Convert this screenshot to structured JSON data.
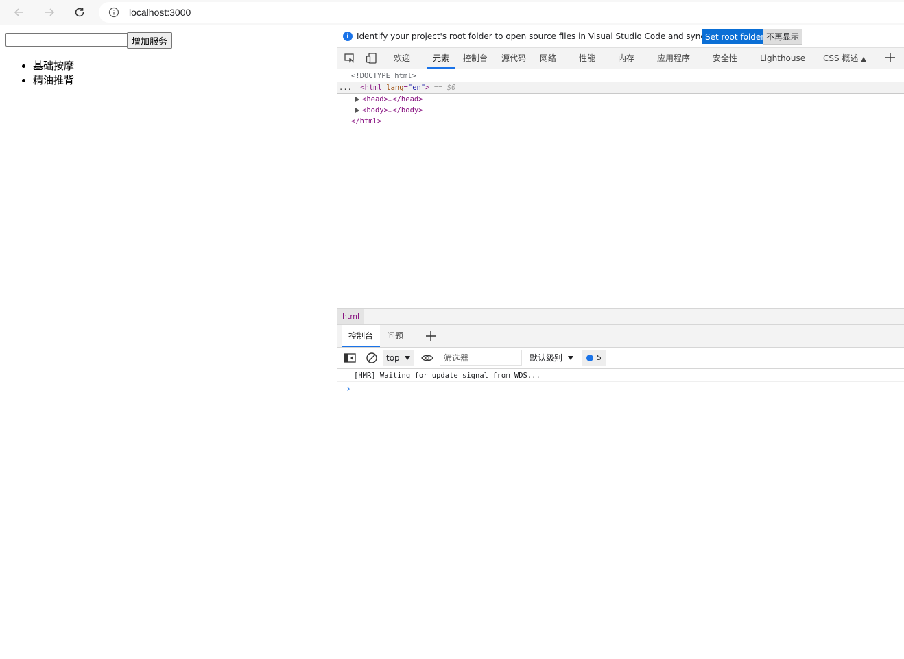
{
  "browser": {
    "url": "localhost:3000",
    "icons": {
      "back": "arrow-left-icon",
      "forward": "arrow-right-icon",
      "reload": "reload-icon",
      "info": "info-icon"
    }
  },
  "page": {
    "input_value": "",
    "add_button_label": "增加服务",
    "services": [
      "基础按摩",
      "精油推背"
    ]
  },
  "devtools": {
    "infobar": {
      "message": "Identify your project's root folder to open source files in Visual Studio Code and sync changes.",
      "set_root_label": "Set root folder",
      "dismiss_label": "不再显示"
    },
    "tabs": [
      "欢迎",
      "元素",
      "控制台",
      "源代码",
      "网络",
      "性能",
      "内存",
      "应用程序",
      "安全性",
      "Lighthouse",
      "CSS 概述"
    ],
    "active_tab": "元素",
    "dom": {
      "doctype": "<!DOCTYPE html>",
      "html_open_tag": "html",
      "html_attr_name": "lang",
      "html_attr_value": "\"en\"",
      "selected_marker": "== $0",
      "ellipsis": "...",
      "head_text": "head",
      "body_text": "body",
      "html_close": "/html"
    },
    "breadcrumb": "html",
    "drawer_tabs": [
      "控制台",
      "问题"
    ],
    "console": {
      "context": "top",
      "filter_placeholder": "筛选器",
      "level": "默认级别",
      "message_count": "5",
      "log_line": "[HMR] Waiting for update signal from WDS...",
      "prompt": "›"
    },
    "colors": {
      "accent": "#1a73e8",
      "primary_button": "#0b6fd6",
      "tag": "#881280"
    }
  }
}
